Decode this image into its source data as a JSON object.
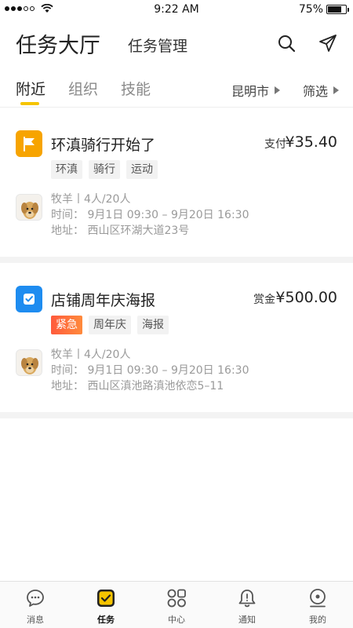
{
  "status_bar": {
    "time": "9:22 AM",
    "battery": "75%",
    "battery_level": 0.75
  },
  "header": {
    "title": "任务大厅",
    "subtitle": "任务管理",
    "search_icon": "search-icon",
    "send_icon": "send-icon"
  },
  "tabs": {
    "items": [
      {
        "label": "附近",
        "active": true
      },
      {
        "label": "组织",
        "active": false
      },
      {
        "label": "技能",
        "active": false
      }
    ],
    "city": "昆明市",
    "filter": "筛选",
    "indicator_color": "#f5c400"
  },
  "tasks": [
    {
      "icon": "flag-icon",
      "icon_color": "#f7a400",
      "title": "环滇骑行开始了",
      "pay_label": "支付",
      "pay_amount": "¥35.40",
      "tags": [
        "环滇",
        "骑行",
        "运动"
      ],
      "publisher": "牧羊丨4人/20人",
      "time": "时间：  9月1日 09:30 – 9月20日 16:30",
      "address": "地址：  西山区环湖大道23号"
    },
    {
      "icon": "checkbox-icon",
      "icon_color": "#1e8cf0",
      "title": "店铺周年庆海报",
      "pay_label": "赏金",
      "pay_amount": "¥500.00",
      "urgent_tag": "紧急",
      "tags": [
        "周年庆",
        "海报"
      ],
      "publisher": "牧羊丨4人/20人",
      "time": "时间：  9月1日 09:30 – 9月20日 16:30",
      "address": "地址：  西山区滇池路滇池依恋5–11"
    }
  ],
  "bottom_nav": [
    {
      "label": "消息",
      "icon": "message-icon",
      "active": false
    },
    {
      "label": "任务",
      "icon": "task-icon",
      "active": true
    },
    {
      "label": "中心",
      "icon": "grid-icon",
      "active": false
    },
    {
      "label": "通知",
      "icon": "bell-icon",
      "active": false
    },
    {
      "label": "我的",
      "icon": "profile-icon",
      "active": false
    }
  ]
}
